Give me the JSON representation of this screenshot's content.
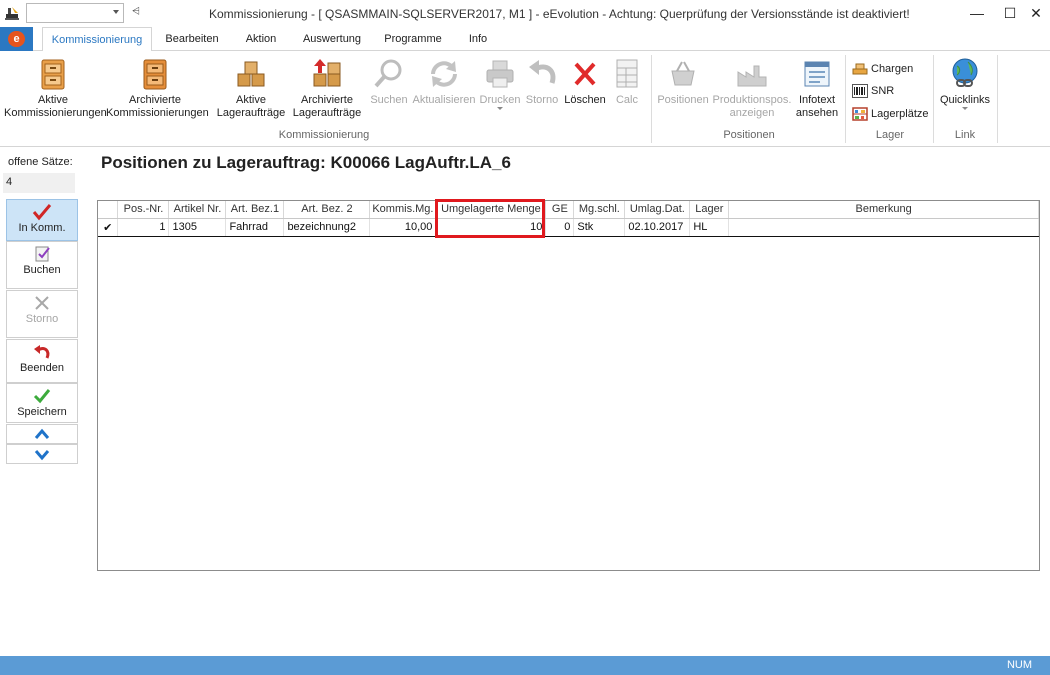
{
  "window": {
    "title": "Kommissionierung - [ QSASMMAIN-SQLSERVER2017, M1 ]  -  eEvolution - Achtung: Querprüfung der Versionsstände ist deaktiviert!",
    "quick_access_more": "⩤",
    "minimize_glyph": "—",
    "maximize_glyph": "☐",
    "close_glyph": "✕"
  },
  "ribbon_tabs": [
    "Kommissionierung",
    "Bearbeiten",
    "Aktion",
    "Auswertung",
    "Programme",
    "Info"
  ],
  "ribbon": {
    "active_kommissionierungen": "Aktive\nKommissionierungen",
    "archivierte_kommissionierungen": "Archivierte\nKommissionierungen",
    "aktive_lagerauftraege": "Aktive\nLageraufträge",
    "archivierte_lagerauftraege": "Archivierte\nLageraufträge",
    "suchen": "Suchen",
    "aktualisieren": "Aktualisieren",
    "drucken": "Drucken",
    "storno": "Storno",
    "loeschen": "Löschen",
    "calc": "Calc",
    "positionen": "Positionen",
    "produktionspos": "Produktionspos.\nanzeigen",
    "infotext": "Infotext\nansehen",
    "chargen": "Chargen",
    "snr": "SNR",
    "lagerplaetze": "Lagerplätze",
    "quicklinks": "Quicklinks",
    "group_kommissionierung": "Kommissionierung",
    "group_positionen": "Positionen",
    "group_lager": "Lager",
    "group_link": "Link"
  },
  "sidebar": {
    "open_label": "offene Sätze:",
    "open_value": "4",
    "buttons": {
      "in_komm": "In Komm.",
      "buchen": "Buchen",
      "storno": "Storno",
      "beenden": "Beenden",
      "speichern": "Speichern"
    }
  },
  "main": {
    "heading": "Positionen zu Lagerauftrag: K00066 LagAuftr.LA_6"
  },
  "grid": {
    "columns": [
      "",
      "Pos.-Nr.",
      "Artikel Nr.",
      "Art. Bez.1",
      "Art. Bez. 2",
      "Kommis.Mg.",
      "Umgelagerte Menge",
      "GE",
      "Mg.schl.",
      "Umlag.Dat.",
      "Lager",
      "Bemerkung"
    ],
    "rows": [
      [
        "✔",
        "1",
        "1305",
        "Fahrrad",
        "bezeichnung2",
        "10,00",
        "10",
        "0",
        "Stk",
        "02.10.2017",
        "HL",
        ""
      ]
    ]
  },
  "statusbar": {
    "num": "NUM"
  },
  "colors": {
    "accent": "#2b78c2",
    "statusbar": "#5b9bd5",
    "highlight": "#e0191e",
    "brand_badge": "#e6541d"
  }
}
